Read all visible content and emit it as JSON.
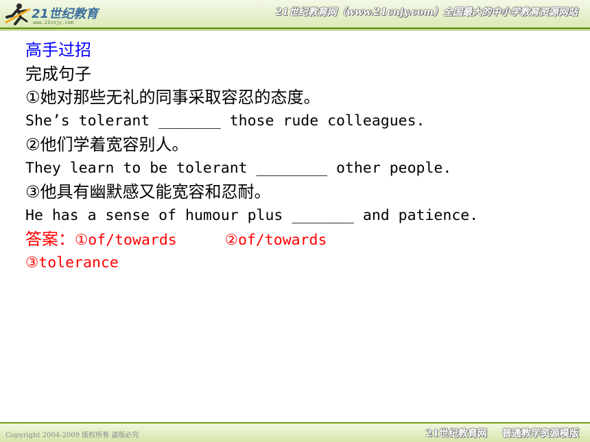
{
  "header": {
    "logo_brand": "21世纪教育",
    "logo_url": "www.21cnjy.com",
    "slogan": "21世纪教育网（www.21cnjy.com）全国最大的中小学教育资源网站",
    "logo_icon": "running-figure-icon"
  },
  "content": {
    "title": "高手过招",
    "subtitle": "完成句子",
    "items": [
      {
        "cn": "①她对那些无礼的同事采取容忍的态度。",
        "en": "She’s tolerant _______ those rude colleagues."
      },
      {
        "cn": "②他们学着宽容别人。",
        "en": "They learn to be tolerant ________ other people."
      },
      {
        "cn": "③他具有幽默感又能宽容和忍耐。",
        "en": "He has a sense of humour plus _______ and patience."
      }
    ],
    "answer_label": "答案：",
    "answers": [
      "①of/towards",
      "②of/towards",
      "③tolerance"
    ]
  },
  "footer": {
    "copyright": "Copyright 2004-2009 版权所有 盗版必究",
    "site": "21世纪教育网",
    "tagline": "普通教学资源模版"
  },
  "colors": {
    "title": "#0000ff",
    "answer": "#ff0000",
    "header_rule": "#6f9a18"
  }
}
